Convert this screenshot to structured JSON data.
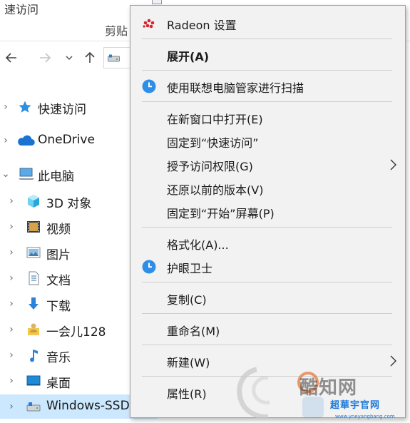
{
  "ribbon": {
    "top_text": "速访问",
    "group_label": "剪贴"
  },
  "address_bar": {
    "back_icon": "arrow-left-icon",
    "forward_icon": "arrow-right-icon",
    "recent_icon": "chevron-down-icon",
    "up_icon": "arrow-up-icon"
  },
  "nav_tree": {
    "items": [
      {
        "label": "快速访问",
        "icon": "star-icon",
        "chevron": "›"
      },
      {
        "label": "OneDrive",
        "icon": "cloud-icon",
        "chevron": "›"
      },
      {
        "label": "此电脑",
        "icon": "computer-icon",
        "chevron": "⌄"
      },
      {
        "label": "3D 对象",
        "icon": "cube-icon",
        "chevron": "›"
      },
      {
        "label": "视频",
        "icon": "film-icon",
        "chevron": "›"
      },
      {
        "label": "图片",
        "icon": "picture-icon",
        "chevron": "›"
      },
      {
        "label": "文档",
        "icon": "document-icon",
        "chevron": "›"
      },
      {
        "label": "下载",
        "icon": "download-icon",
        "chevron": "›"
      },
      {
        "label": "一会儿128",
        "icon": "user-folder-icon",
        "chevron": "›"
      },
      {
        "label": "音乐",
        "icon": "music-note-icon",
        "chevron": "›"
      },
      {
        "label": "桌面",
        "icon": "desktop-icon",
        "chevron": "›"
      },
      {
        "label": "Windows-SSD (C:)",
        "icon": "drive-icon",
        "chevron": "›"
      }
    ]
  },
  "context_menu": {
    "items": [
      {
        "label": "Radeon 设置",
        "icon": "radeon-icon"
      },
      {
        "label": "展开(A)",
        "bold": true
      },
      {
        "label": "使用联想电脑管家进行扫描",
        "icon": "lenovo-pc-manager-icon"
      },
      {
        "label": "在新窗口中打开(E)"
      },
      {
        "label": "固定到“快速访问”"
      },
      {
        "label": "授予访问权限(G)",
        "submenu": true
      },
      {
        "label": "还原以前的版本(V)"
      },
      {
        "label": "固定到“开始”屏幕(P)"
      },
      {
        "label": "格式化(A)..."
      },
      {
        "label": "护眼卫士",
        "icon": "eye-guard-icon"
      },
      {
        "label": "复制(C)"
      },
      {
        "label": "重命名(M)"
      },
      {
        "label": "新建(W)",
        "submenu": true
      },
      {
        "label": "属性(R)"
      }
    ]
  },
  "watermark": {
    "line1": "酷知网",
    "line2": "超華宇官网",
    "line3": "www.yneyangbang.com"
  },
  "colors": {
    "menu_bg": "#f2f2f2",
    "selection": "#cce8ff",
    "lenovo_blue": "#2f8ee8",
    "radeon_red": "#d8242c"
  }
}
